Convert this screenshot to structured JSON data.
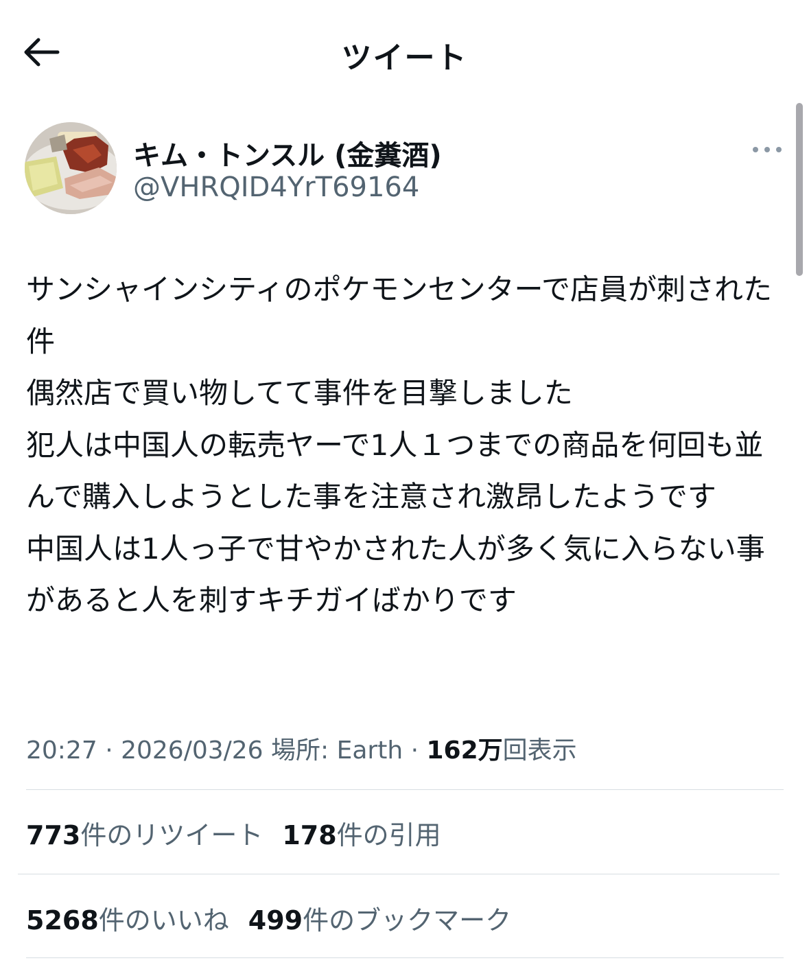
{
  "header": {
    "title": "ツイート",
    "back_icon": "arrow-left-icon"
  },
  "author": {
    "name": "キム・トンスル (金糞酒)",
    "handle": "@VHRQID4YrT69164",
    "avatar_icon": "food-photo-avatar"
  },
  "more_icon": "more-horizontal-icon",
  "tweet": {
    "text": "サンシャインシティのポケモンセンターで店員が刺された件\n偶然店で買い物してて事件を目撃しました\n犯人は中国人の転売ヤーで1人１つまでの商品を何回も並んで購入しようとした事を注意され激昂したようです\n中国人は1人っ子で甘やかされた人が多く気に入らない事があると人を刺すキチガイばかりです"
  },
  "meta": {
    "time": "20:27",
    "sep1": " · ",
    "date": "2026/03/26",
    "location": " 場所: Earth",
    "sep2": " · ",
    "views_count": "162万",
    "views_label": "回表示"
  },
  "stats": {
    "retweets_count": "773",
    "retweets_label": "件のリツイート",
    "quotes_count": "178",
    "quotes_label": "件の引用",
    "likes_count": "5268",
    "likes_label": "件のいいね",
    "bookmarks_count": "499",
    "bookmarks_label": "件のブックマーク"
  },
  "colors": {
    "text_primary": "#0f1419",
    "text_secondary": "#536471",
    "divider": "#d7dde2"
  }
}
